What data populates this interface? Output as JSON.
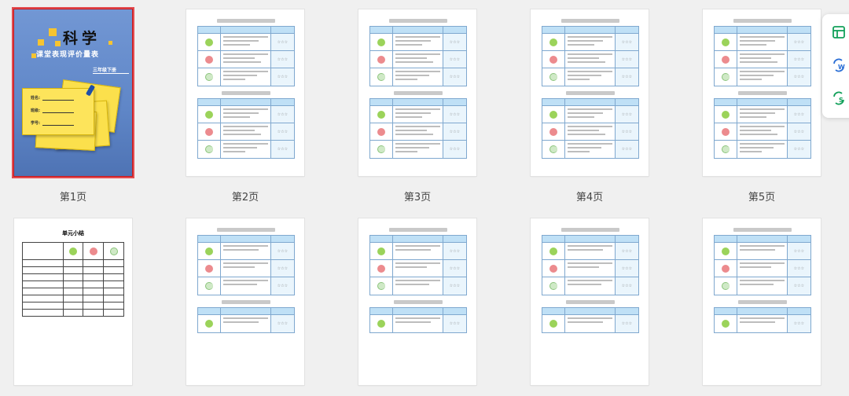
{
  "cover": {
    "title": "科学",
    "subtitle": "课堂表现评价量表",
    "grade": "三年级下册",
    "fields": [
      "姓名:",
      "班级:",
      "学号:"
    ]
  },
  "page_labels": [
    "第1页",
    "第2页",
    "第3页",
    "第4页",
    "第5页"
  ],
  "summary": {
    "title": "单元小结"
  },
  "star_text": "☆☆☆",
  "side_tools": [
    "pdf-to-excel",
    "pdf-to-word",
    "pdf-to-pdf"
  ],
  "colors": {
    "selected_border": "#c4171c",
    "table_header": "#bfe0f6",
    "table_border": "#7fa8cf"
  }
}
